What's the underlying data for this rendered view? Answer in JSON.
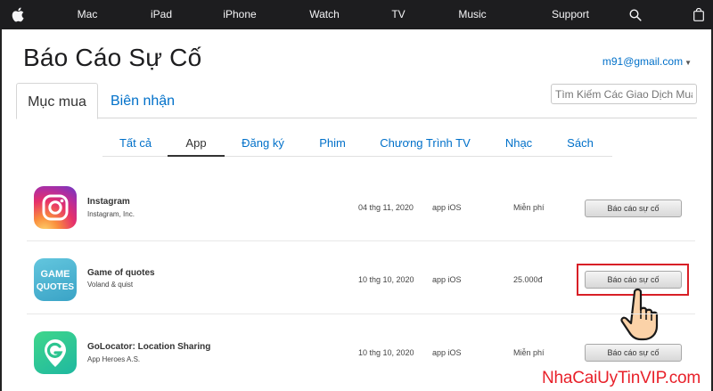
{
  "nav": {
    "items": [
      "Mac",
      "iPad",
      "iPhone",
      "Watch",
      "TV",
      "Music",
      "Support"
    ],
    "icons": [
      "apple-logo-icon",
      "search-icon",
      "bag-icon"
    ]
  },
  "header": {
    "title": "Báo Cáo Sự Cố",
    "account": "m91@gmail.com"
  },
  "main_tabs": {
    "purchases": "Mục mua",
    "receipts": "Biên nhận"
  },
  "search": {
    "placeholder": "Tìm Kiếm Các Giao Dịch Mua H"
  },
  "category_tabs": [
    "Tất cả",
    "App",
    "Đăng ký",
    "Phim",
    "Chương Trình TV",
    "Nhạc",
    "Sách"
  ],
  "selected_category": "App",
  "rows": [
    {
      "name": "Instagram",
      "developer": "Instagram, Inc.",
      "date": "04 thg 11, 2020",
      "type": "app iOS",
      "price": "Miễn phí",
      "action": "Báo cáo sự cố",
      "icon": "instagram-icon"
    },
    {
      "name": "Game of quotes",
      "developer": "Voland & quist",
      "date": "10 thg 10, 2020",
      "type": "app iOS",
      "price": "25.000đ",
      "action": "Báo cáo sự cố",
      "icon": "game-of-quotes-icon"
    },
    {
      "name": "GoLocator: Location Sharing",
      "developer": "App Heroes A.S.",
      "date": "10 thg 10, 2020",
      "type": "app iOS",
      "price": "Miễn phí",
      "action": "Báo cáo sự cố",
      "icon": "golocator-icon"
    }
  ],
  "game_icon_text": [
    "GAME",
    "QUOTES"
  ],
  "watermark": "NhaCaiUyTinVIP.com",
  "colors": {
    "link": "#0070c9",
    "nav_bg": "#1d1d1f",
    "highlight": "#d81f26"
  }
}
